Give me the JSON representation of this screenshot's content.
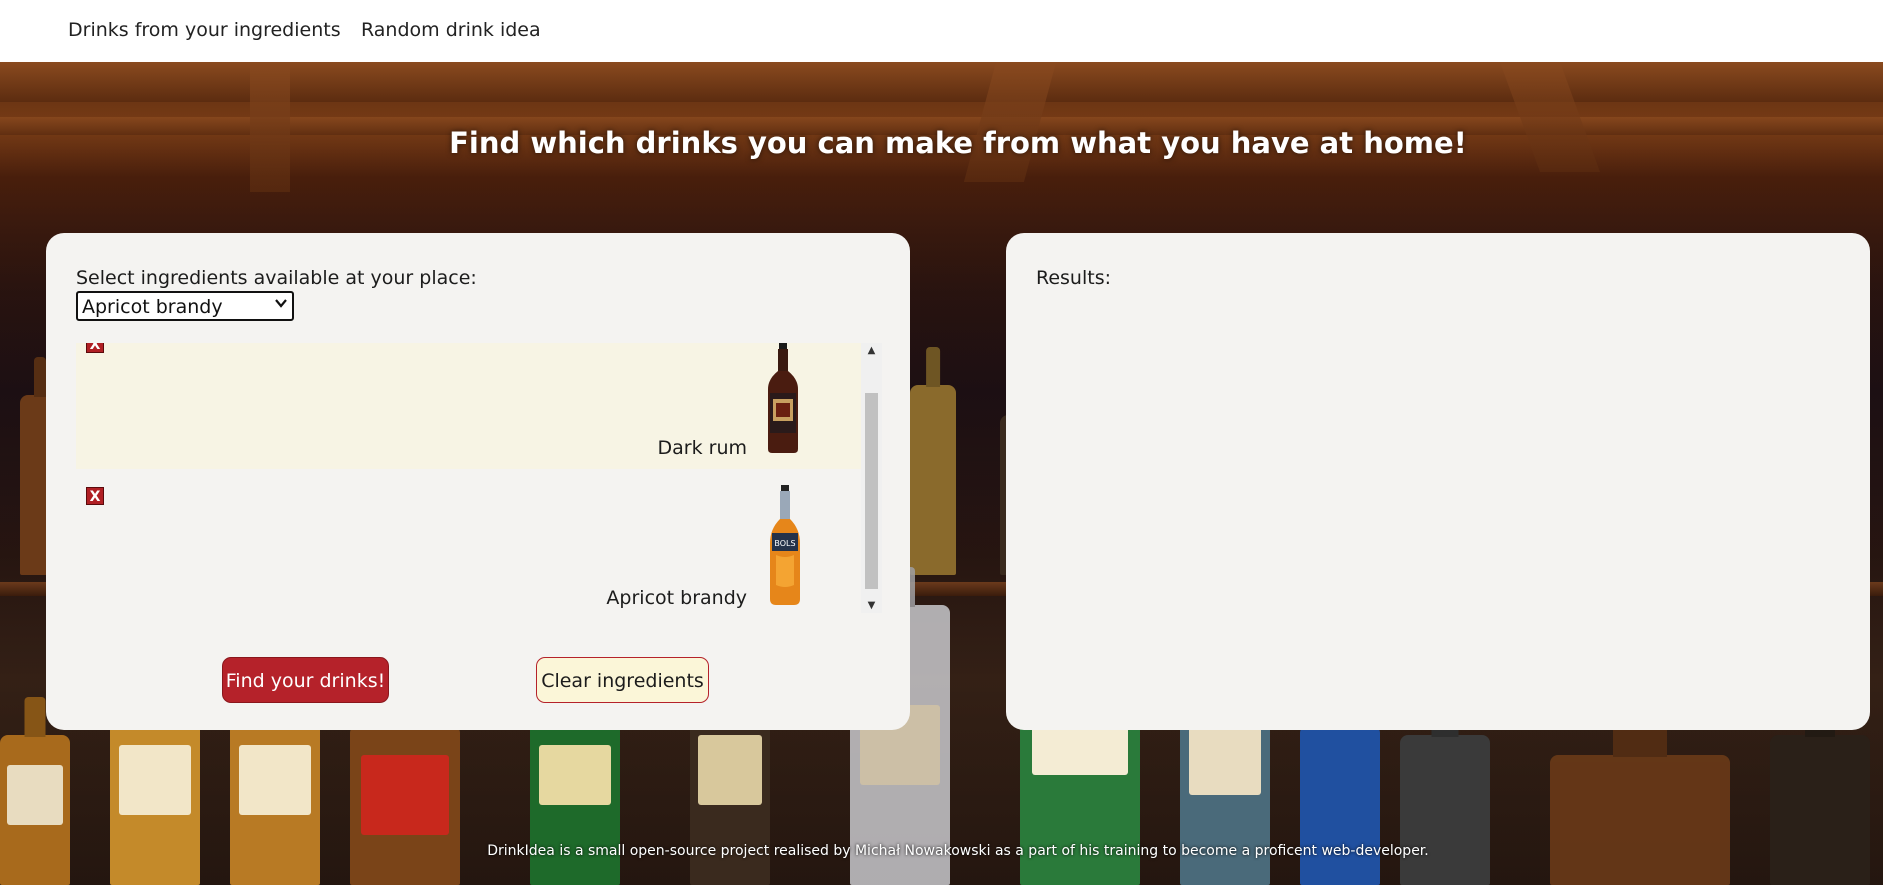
{
  "nav": {
    "items": [
      {
        "label": "Drinks from your ingredients"
      },
      {
        "label": "Random drink idea"
      }
    ]
  },
  "hero": {
    "headline": "Find which drinks you can make from what you have at home!"
  },
  "ingredients_panel": {
    "prompt": "Select ingredients available at your place:",
    "select": {
      "selected": "Apricot brandy"
    },
    "items": [
      {
        "name": "Dark rum",
        "remove_label": "X",
        "image_icon": "dark-rum-bottle-icon"
      },
      {
        "name": "Apricot brandy",
        "remove_label": "X",
        "image_icon": "apricot-brandy-bottle-icon"
      }
    ],
    "find_button": "Find your drinks!",
    "clear_button": "Clear ingredients"
  },
  "results_panel": {
    "label": "Results:"
  },
  "footer": {
    "text": "DrinkIdea is a small open-source project realised by Michał Nowakowski as a part of his training to become a proficent web-developer."
  },
  "colors": {
    "primary_red": "#b5222a",
    "panel_bg": "#f4f3f1",
    "highlight_row": "#f7f4e4",
    "clear_button_bg": "#fbf6d8"
  }
}
